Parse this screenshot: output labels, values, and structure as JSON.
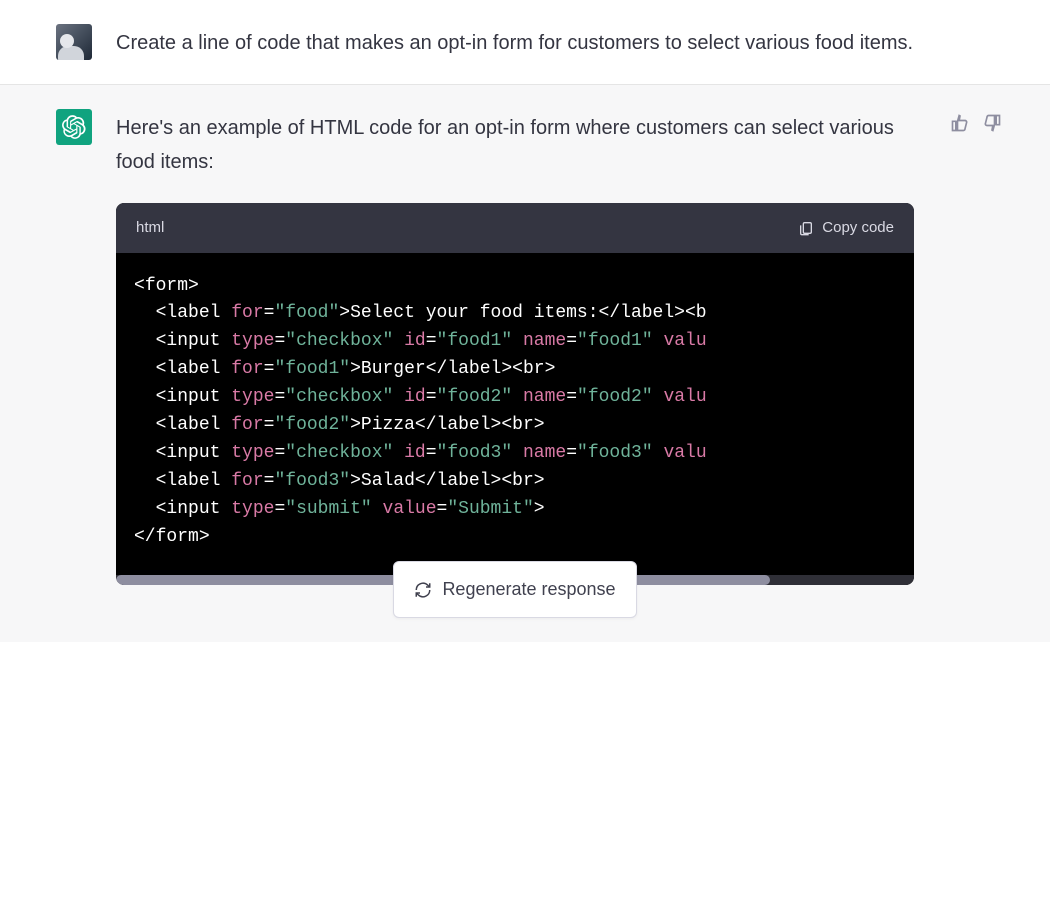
{
  "user_message": {
    "text": "Create a line of code that makes an opt-in form for customers to select various food items."
  },
  "assistant_message": {
    "intro": "Here's an example of HTML code for an opt-in form where customers can select various food items:"
  },
  "codeblock": {
    "language": "html",
    "copy_label": "Copy code",
    "lines": [
      {
        "indent": 0,
        "tokens": [
          {
            "t": "punct",
            "v": "<"
          },
          {
            "t": "tag",
            "v": "form"
          },
          {
            "t": "punct",
            "v": ">"
          }
        ]
      },
      {
        "indent": 1,
        "tokens": [
          {
            "t": "punct",
            "v": "<"
          },
          {
            "t": "tag",
            "v": "label"
          },
          {
            "t": "txt",
            "v": " "
          },
          {
            "t": "attr",
            "v": "for"
          },
          {
            "t": "eq",
            "v": "="
          },
          {
            "t": "str",
            "v": "\"food\""
          },
          {
            "t": "punct",
            "v": ">"
          },
          {
            "t": "txt",
            "v": "Select your food items:"
          },
          {
            "t": "punct",
            "v": "</"
          },
          {
            "t": "tag",
            "v": "label"
          },
          {
            "t": "punct",
            "v": ">"
          },
          {
            "t": "punct",
            "v": "<"
          },
          {
            "t": "tag",
            "v": "b"
          }
        ]
      },
      {
        "indent": 1,
        "tokens": [
          {
            "t": "punct",
            "v": "<"
          },
          {
            "t": "tag",
            "v": "input"
          },
          {
            "t": "txt",
            "v": " "
          },
          {
            "t": "attr",
            "v": "type"
          },
          {
            "t": "eq",
            "v": "="
          },
          {
            "t": "str",
            "v": "\"checkbox\""
          },
          {
            "t": "txt",
            "v": " "
          },
          {
            "t": "attr",
            "v": "id"
          },
          {
            "t": "eq",
            "v": "="
          },
          {
            "t": "str",
            "v": "\"food1\""
          },
          {
            "t": "txt",
            "v": " "
          },
          {
            "t": "attr",
            "v": "name"
          },
          {
            "t": "eq",
            "v": "="
          },
          {
            "t": "str",
            "v": "\"food1\""
          },
          {
            "t": "txt",
            "v": " "
          },
          {
            "t": "attr",
            "v": "valu"
          }
        ]
      },
      {
        "indent": 1,
        "tokens": [
          {
            "t": "punct",
            "v": "<"
          },
          {
            "t": "tag",
            "v": "label"
          },
          {
            "t": "txt",
            "v": " "
          },
          {
            "t": "attr",
            "v": "for"
          },
          {
            "t": "eq",
            "v": "="
          },
          {
            "t": "str",
            "v": "\"food1\""
          },
          {
            "t": "punct",
            "v": ">"
          },
          {
            "t": "txt",
            "v": "Burger"
          },
          {
            "t": "punct",
            "v": "</"
          },
          {
            "t": "tag",
            "v": "label"
          },
          {
            "t": "punct",
            "v": ">"
          },
          {
            "t": "punct",
            "v": "<"
          },
          {
            "t": "tag",
            "v": "br"
          },
          {
            "t": "punct",
            "v": ">"
          }
        ]
      },
      {
        "indent": 1,
        "tokens": [
          {
            "t": "punct",
            "v": "<"
          },
          {
            "t": "tag",
            "v": "input"
          },
          {
            "t": "txt",
            "v": " "
          },
          {
            "t": "attr",
            "v": "type"
          },
          {
            "t": "eq",
            "v": "="
          },
          {
            "t": "str",
            "v": "\"checkbox\""
          },
          {
            "t": "txt",
            "v": " "
          },
          {
            "t": "attr",
            "v": "id"
          },
          {
            "t": "eq",
            "v": "="
          },
          {
            "t": "str",
            "v": "\"food2\""
          },
          {
            "t": "txt",
            "v": " "
          },
          {
            "t": "attr",
            "v": "name"
          },
          {
            "t": "eq",
            "v": "="
          },
          {
            "t": "str",
            "v": "\"food2\""
          },
          {
            "t": "txt",
            "v": " "
          },
          {
            "t": "attr",
            "v": "valu"
          }
        ]
      },
      {
        "indent": 1,
        "tokens": [
          {
            "t": "punct",
            "v": "<"
          },
          {
            "t": "tag",
            "v": "label"
          },
          {
            "t": "txt",
            "v": " "
          },
          {
            "t": "attr",
            "v": "for"
          },
          {
            "t": "eq",
            "v": "="
          },
          {
            "t": "str",
            "v": "\"food2\""
          },
          {
            "t": "punct",
            "v": ">"
          },
          {
            "t": "txt",
            "v": "Pizza"
          },
          {
            "t": "punct",
            "v": "</"
          },
          {
            "t": "tag",
            "v": "label"
          },
          {
            "t": "punct",
            "v": ">"
          },
          {
            "t": "punct",
            "v": "<"
          },
          {
            "t": "tag",
            "v": "br"
          },
          {
            "t": "punct",
            "v": ">"
          }
        ]
      },
      {
        "indent": 1,
        "tokens": [
          {
            "t": "punct",
            "v": "<"
          },
          {
            "t": "tag",
            "v": "input"
          },
          {
            "t": "txt",
            "v": " "
          },
          {
            "t": "attr",
            "v": "type"
          },
          {
            "t": "eq",
            "v": "="
          },
          {
            "t": "str",
            "v": "\"checkbox\""
          },
          {
            "t": "txt",
            "v": " "
          },
          {
            "t": "attr",
            "v": "id"
          },
          {
            "t": "eq",
            "v": "="
          },
          {
            "t": "str",
            "v": "\"food3\""
          },
          {
            "t": "txt",
            "v": " "
          },
          {
            "t": "attr",
            "v": "name"
          },
          {
            "t": "eq",
            "v": "="
          },
          {
            "t": "str",
            "v": "\"food3\""
          },
          {
            "t": "txt",
            "v": " "
          },
          {
            "t": "attr",
            "v": "valu"
          }
        ]
      },
      {
        "indent": 1,
        "tokens": [
          {
            "t": "punct",
            "v": "<"
          },
          {
            "t": "tag",
            "v": "label"
          },
          {
            "t": "txt",
            "v": " "
          },
          {
            "t": "attr",
            "v": "for"
          },
          {
            "t": "eq",
            "v": "="
          },
          {
            "t": "str",
            "v": "\"food3\""
          },
          {
            "t": "punct",
            "v": ">"
          },
          {
            "t": "txt",
            "v": "Salad"
          },
          {
            "t": "punct",
            "v": "</"
          },
          {
            "t": "tag",
            "v": "label"
          },
          {
            "t": "punct",
            "v": ">"
          },
          {
            "t": "punct",
            "v": "<"
          },
          {
            "t": "tag",
            "v": "br"
          },
          {
            "t": "punct",
            "v": ">"
          }
        ]
      },
      {
        "indent": 1,
        "tokens": [
          {
            "t": "punct",
            "v": "<"
          },
          {
            "t": "tag",
            "v": "input"
          },
          {
            "t": "txt",
            "v": " "
          },
          {
            "t": "attr",
            "v": "type"
          },
          {
            "t": "eq",
            "v": "="
          },
          {
            "t": "str",
            "v": "\"submit\""
          },
          {
            "t": "txt",
            "v": " "
          },
          {
            "t": "attr",
            "v": "value"
          },
          {
            "t": "eq",
            "v": "="
          },
          {
            "t": "str",
            "v": "\"Submit\""
          },
          {
            "t": "punct",
            "v": ">"
          }
        ]
      },
      {
        "indent": 0,
        "tokens": [
          {
            "t": "punct",
            "v": "</"
          },
          {
            "t": "tag",
            "v": "form"
          },
          {
            "t": "punct",
            "v": ">"
          }
        ]
      }
    ]
  },
  "regenerate_label": "Regenerate response"
}
